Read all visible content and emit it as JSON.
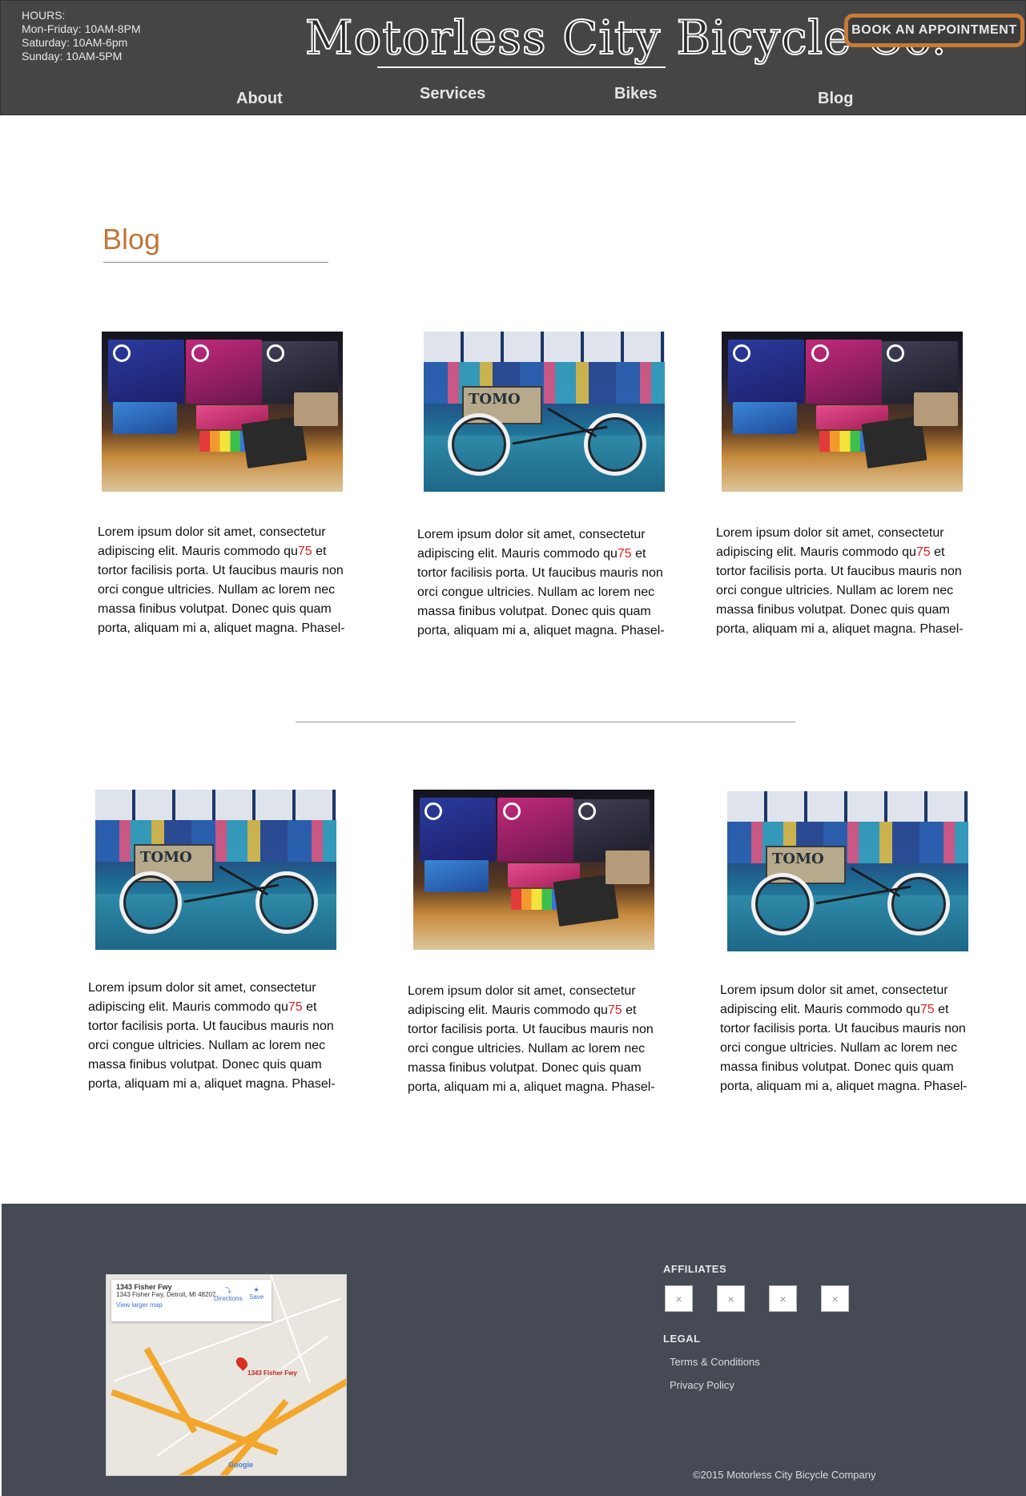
{
  "header": {
    "hours_label": "HOURS:",
    "hours_weekday": "Mon-Friday: 10AM-8PM",
    "hours_saturday": "Saturday: 10AM-6pm",
    "hours_sunday": "Sunday: 10AM-5PM",
    "logo_text": "Motorless City Bicycle Co.",
    "book_button": "BOOK AN APPOINTMENT"
  },
  "nav": {
    "about": "About",
    "services": "Services",
    "bikes": "Bikes",
    "blog": "Blog"
  },
  "page": {
    "title": "Blog"
  },
  "posts": [
    {
      "image": "bike-lights-display",
      "text_before": "Lorem ipsum dolor sit amet, consectetur adipiscing elit. Mauris commodo qu",
      "highlight": "75",
      "text_after": " et tortor facilisis porta. Ut faucibus mauris non orci congue ultricies. Nullam ac lorem nec massa finibus volutpat. Donec quis quam porta, aliquam mi a, aliquet magna. Phasel-"
    },
    {
      "image": "tomo-cargo-bike",
      "text_before": "Lorem ipsum dolor sit amet, consectetur adipiscing elit. Mauris commodo qu",
      "highlight": "75",
      "text_after": " et tortor facilisis porta. Ut faucibus mauris non orci congue ultricies. Nullam ac lorem nec massa finibus volutpat. Donec quis quam porta, aliquam mi a, aliquet magna. Phasel-"
    },
    {
      "image": "bike-lights-display",
      "text_before": "Lorem ipsum dolor sit amet, consectetur adipiscing elit. Mauris commodo qu",
      "highlight": "75",
      "text_after": " et tortor facilisis porta. Ut faucibus mauris non orci congue ultricies. Nullam ac lorem nec massa finibus volutpat. Donec quis quam porta, aliquam mi a, aliquet magna. Phasel-"
    },
    {
      "image": "tomo-cargo-bike",
      "text_before": "Lorem ipsum dolor sit amet, consectetur adipiscing elit. Mauris commodo qu",
      "highlight": "75",
      "text_after": " et tortor facilisis porta. Ut faucibus mauris non orci congue ultricies. Nullam ac lorem nec massa finibus volutpat. Donec quis quam porta, aliquam mi a, aliquet magna. Phasel-"
    },
    {
      "image": "bike-lights-display",
      "text_before": "Lorem ipsum dolor sit amet, consectetur adipiscing elit. Mauris commodo qu",
      "highlight": "75",
      "text_after": " et tortor facilisis porta. Ut faucibus mauris non orci congue ultricies. Nullam ac lorem nec massa finibus volutpat. Donec quis quam porta, aliquam mi a, aliquet magna. Phasel-"
    },
    {
      "image": "tomo-cargo-bike",
      "text_before": "Lorem ipsum dolor sit amet, consectetur adipiscing elit. Mauris commodo qu",
      "highlight": "75",
      "text_after": " et tortor facilisis porta. Ut faucibus mauris non orci congue ultricies. Nullam ac lorem nec massa finibus volutpat. Donec quis quam porta, aliquam mi a, aliquet magna. Phasel-"
    }
  ],
  "map": {
    "place_title": "1343 Fisher Fwy",
    "address": "1343 Fisher Fwy, Detroit, MI 48207",
    "directions": "Directions",
    "save": "Save",
    "view_larger": "View larger map",
    "pin_label": "1343 Fisher Fwy",
    "google": "Google"
  },
  "footer": {
    "affiliates_title": "AFFILIATES",
    "affiliate_placeholder": "×",
    "legal_title": "LEGAL",
    "terms": "Terms & Conditions",
    "privacy": "Privacy Policy",
    "copyright": "©2015 Motorless City Bicycle Company"
  },
  "colors": {
    "header_bg": "#454545",
    "accent_orange": "#c0773a",
    "button_border": "#c87a35",
    "footer_bg": "#454a55",
    "highlight_red": "#e02020"
  }
}
